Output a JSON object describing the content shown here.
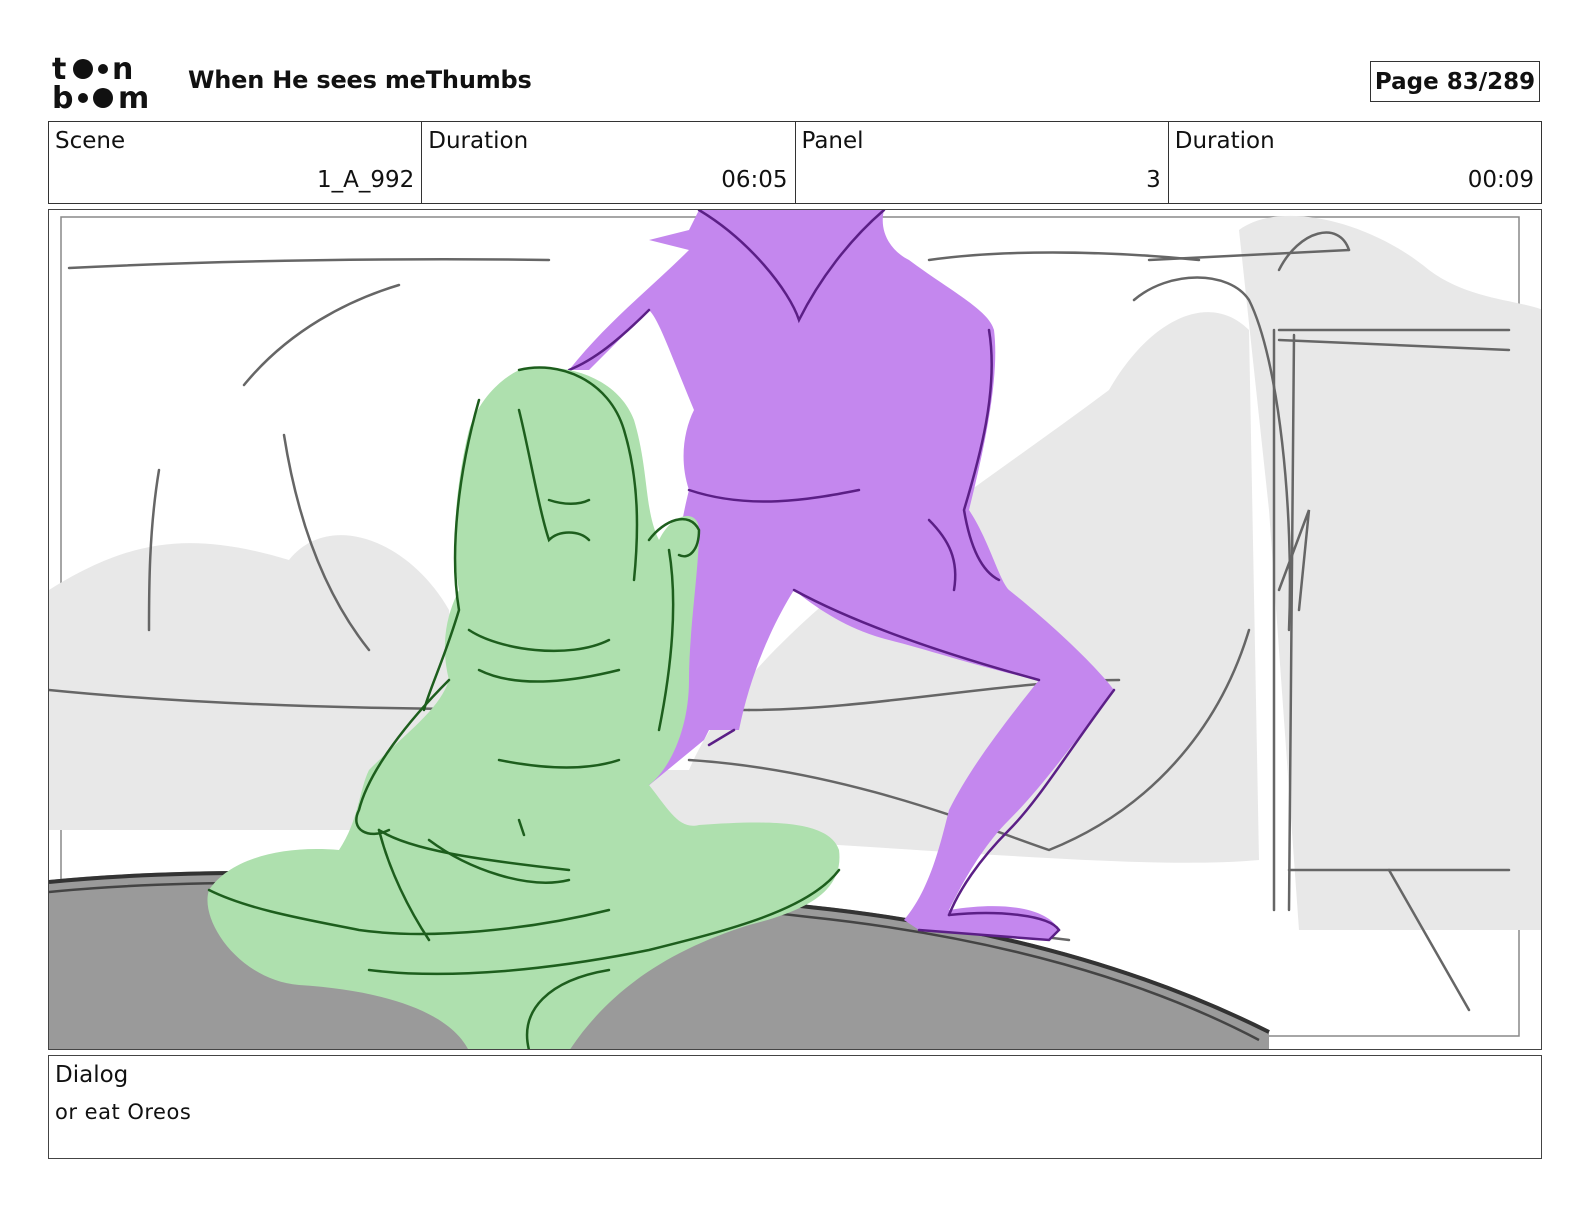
{
  "header": {
    "brand_logo": "toonboom",
    "title": "When He sees meThumbs",
    "page_label": "Page",
    "page_number": "83/289"
  },
  "info": {
    "scene_label": "Scene",
    "scene_value": "1_A_992",
    "duration_label": "Duration",
    "duration_value": "06:05",
    "panel_label": "Panel",
    "panel_value": "3",
    "panel_duration_label": "Duration",
    "panel_duration_value": "00:09"
  },
  "panel": {
    "image": "storyboard-sketch-girl-sitting-and-boy-standing",
    "colors": {
      "girl": "#aee0ae",
      "boy": "#c487ee",
      "floor": "#9a9a9a",
      "shadow": "#e6e6e6"
    }
  },
  "dialog": {
    "label": "Dialog",
    "text": "or eat Oreos"
  }
}
